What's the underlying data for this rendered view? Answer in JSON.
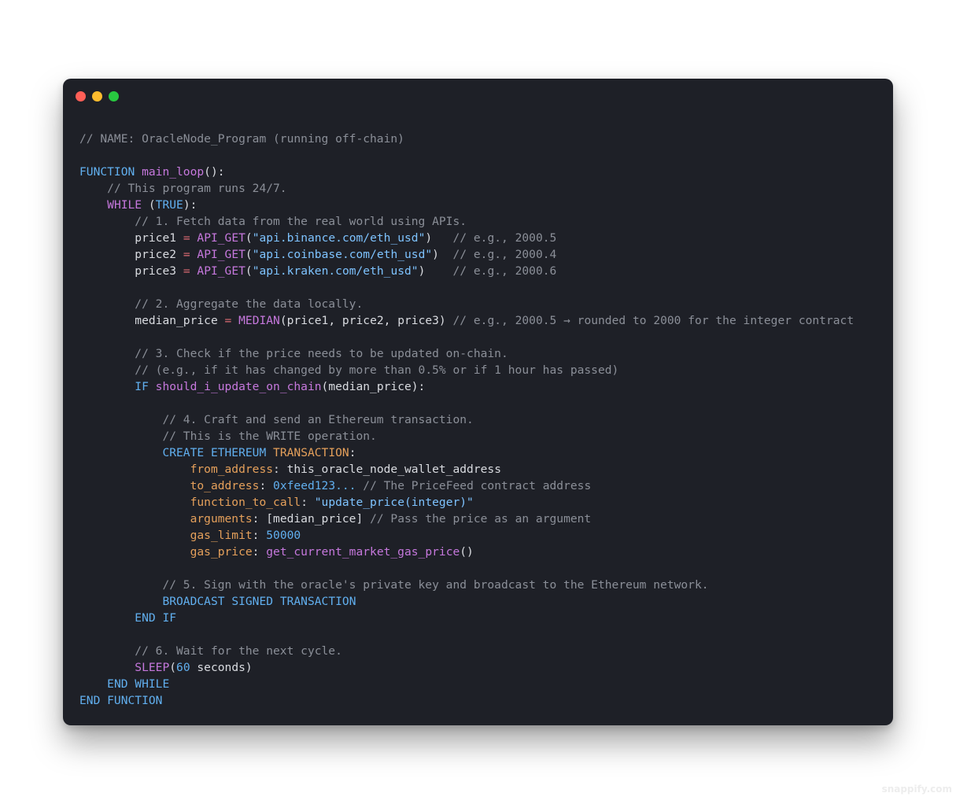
{
  "window": {
    "controls": [
      "close",
      "minimize",
      "maximize"
    ],
    "colors": {
      "close": "#ff5f57",
      "minimize": "#febc2e",
      "maximize": "#28c840",
      "background": "#1e2027"
    }
  },
  "code": {
    "l1": "// NAME: OracleNode_Program (running off-chain)",
    "l3_kw": "FUNCTION",
    "l3_fn": "main_loop",
    "l3_rest": "():",
    "l4": "// This program runs 24/7.",
    "l5_kw": "WHILE",
    "l5_open": " (",
    "l5_val": "TRUE",
    "l5_close": "):",
    "l6": "// 1. Fetch data from the real world using APIs.",
    "l7_var": "price1",
    "l7_eq": "=",
    "l7_fn": "API_GET",
    "l7_str": "\"api.binance.com/eth_usd\"",
    "l7_cm": "// e.g., 2000.5",
    "l8_var": "price2",
    "l8_eq": "=",
    "l8_fn": "API_GET",
    "l8_str": "\"api.coinbase.com/eth_usd\"",
    "l8_cm": "// e.g., 2000.4",
    "l9_var": "price3",
    "l9_eq": "=",
    "l9_fn": "API_GET",
    "l9_str": "\"api.kraken.com/eth_usd\"",
    "l9_cm": "// e.g., 2000.6",
    "l11": "// 2. Aggregate the data locally.",
    "l12_var": "median_price",
    "l12_eq": "=",
    "l12_fn": "MEDIAN",
    "l12_args": "(price1, price2, price3)",
    "l12_cm": "// e.g., 2000.5 → rounded to 2000 for the integer contract",
    "l14": "// 3. Check if the price needs to be updated on-chain.",
    "l15": "// (e.g., if it has changed by more than 0.5% or if 1 hour has passed)",
    "l16_kw": "IF",
    "l16_fn": "should_i_update_on_chain",
    "l16_args": "(median_price):",
    "l18": "// 4. Craft and send an Ethereum transaction.",
    "l19": "// This is the WRITE operation.",
    "l20_kw1": "CREATE",
    "l20_kw2": "ETHEREUM",
    "l20_kw3": "TRANSACTION",
    "l20_colon": ":",
    "l21_key": "from_address",
    "l21_val": "this_oracle_node_wallet_address",
    "l22_key": "to_address",
    "l22_val": "0xfeed123...",
    "l22_cm": "// The PriceFeed contract address",
    "l23_key": "function_to_call",
    "l23_val": "\"update_price(integer)\"",
    "l24_key": "arguments",
    "l24_val": "[median_price]",
    "l24_cm": "// Pass the price as an argument",
    "l25_key": "gas_limit",
    "l25_val": "50000",
    "l26_key": "gas_price",
    "l26_fn": "get_current_market_gas_price",
    "l26_paren": "()",
    "l28": "// 5. Sign with the oracle's private key and broadcast to the Ethereum network.",
    "l29_kw1": "BROADCAST",
    "l29_kw2": "SIGNED",
    "l29_kw3": "TRANSACTION",
    "l30": "END IF",
    "l32": "// 6. Wait for the next cycle.",
    "l33_fn": "SLEEP",
    "l33_open": "(",
    "l33_num": "60",
    "l33_rest": " seconds)",
    "l34": "END WHILE",
    "l35": "END FUNCTION"
  },
  "watermark": "snappify.com"
}
